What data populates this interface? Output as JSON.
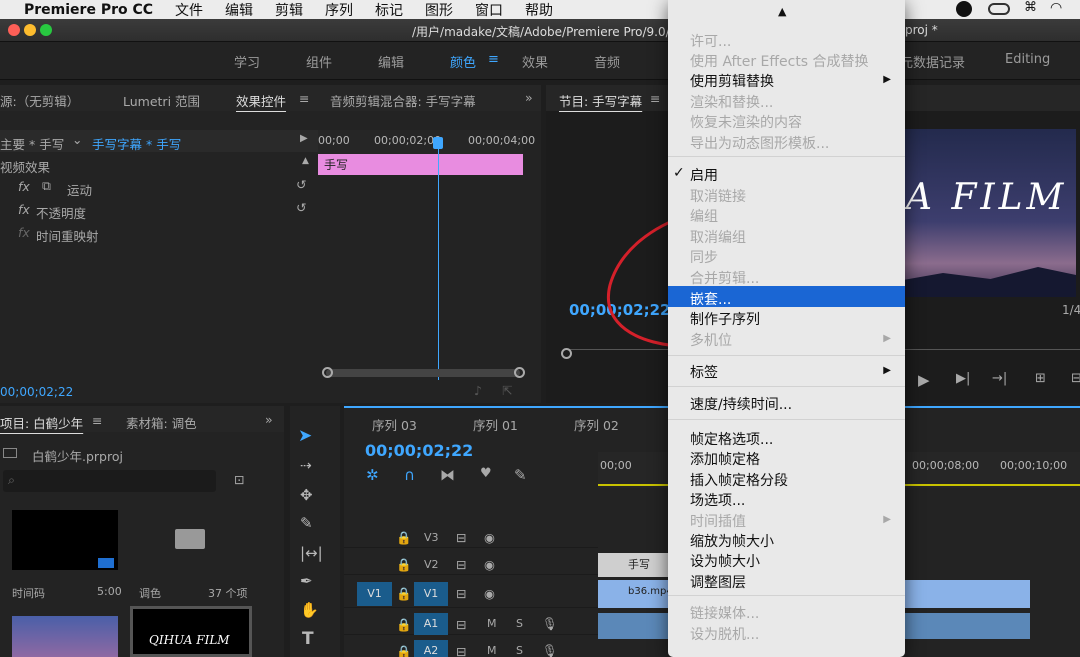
{
  "menubar": {
    "app": "Premiere Pro CC",
    "items": [
      "文件",
      "编辑",
      "剪辑",
      "序列",
      "标记",
      "图形",
      "窗口",
      "帮助"
    ]
  },
  "titlebar": {
    "path": "/用户/madake/文稿/Adobe/Premiere Pro/9.0/A",
    "path_tail": "proj *"
  },
  "workspaces": {
    "items": [
      "学习",
      "组件",
      "编辑",
      "颜色",
      "效果",
      "音频"
    ],
    "active": "颜色",
    "right1": "元数据记录",
    "right2": "Editing"
  },
  "source_panel": {
    "tabs": {
      "source": "源:（无剪辑）",
      "lumetri": "Lumetri 范围",
      "effect_controls": "效果控件",
      "audio_mixer": "音频剪辑混合器: 手写字幕"
    },
    "master": "主要 * 手写",
    "clip": "手写字幕 * 手写",
    "section": "视频效果",
    "effects": [
      "运动",
      "不透明度",
      "时间重映射"
    ],
    "ruler": [
      "00;00",
      "00;00;02;00",
      "00;00;04;00"
    ],
    "clip_label": "手写",
    "timecode": "00;00;02;22"
  },
  "program_panel": {
    "title": "节目: 手写字幕",
    "timecode": "00;00;02;22",
    "film_text": "A FILM",
    "fraction": "1/4"
  },
  "project_panel": {
    "tab": "项目: 白鹤少年",
    "bin_tab": "素材箱: 调色",
    "file": "白鹤少年.prproj",
    "item1_label": "时间码",
    "item1_value": "5:00",
    "item2_label": "调色",
    "item2_value": "37 个项",
    "thumb_text": "QIHUA FILM"
  },
  "timeline": {
    "tabs": [
      "序列 03",
      "序列 01",
      "序列 02"
    ],
    "timecode": "00;00;02;22",
    "ruler": [
      "00;00",
      "00;00;08;00",
      "00;00;10;00"
    ],
    "tracks": [
      "V3",
      "V2",
      "V1",
      "A1",
      "A2"
    ],
    "source_track": "V1",
    "clip1": "手写",
    "clip2": "b36.mp4"
  },
  "context_menu": {
    "items": [
      {
        "label": "许可...",
        "disabled": true
      },
      {
        "label": "使用 After Effects 合成替换",
        "disabled": true
      },
      {
        "label": "使用剪辑替换",
        "disabled": false,
        "submenu": true
      },
      {
        "label": "渲染和替换...",
        "disabled": true
      },
      {
        "label": "恢复未渲染的内容",
        "disabled": true
      },
      {
        "label": "导出为动态图形模板...",
        "disabled": true
      },
      {
        "label": "启用",
        "disabled": false,
        "checked": true
      },
      {
        "label": "取消链接",
        "disabled": true
      },
      {
        "label": "编组",
        "disabled": true
      },
      {
        "label": "取消编组",
        "disabled": true
      },
      {
        "label": "同步",
        "disabled": true
      },
      {
        "label": "合并剪辑...",
        "disabled": true
      },
      {
        "label": "嵌套...",
        "disabled": false,
        "selected": true
      },
      {
        "label": "制作子序列",
        "disabled": false
      },
      {
        "label": "多机位",
        "disabled": true,
        "submenu": true
      },
      {
        "label": "标签",
        "disabled": false,
        "submenu": true
      },
      {
        "label": "速度/持续时间...",
        "disabled": false
      },
      {
        "label": "帧定格选项...",
        "disabled": false
      },
      {
        "label": "添加帧定格",
        "disabled": false
      },
      {
        "label": "插入帧定格分段",
        "disabled": false
      },
      {
        "label": "场选项...",
        "disabled": false
      },
      {
        "label": "时间插值",
        "disabled": true,
        "submenu": true
      },
      {
        "label": "缩放为帧大小",
        "disabled": false
      },
      {
        "label": "设为帧大小",
        "disabled": false
      },
      {
        "label": "调整图层",
        "disabled": false
      },
      {
        "label": "链接媒体...",
        "disabled": true
      },
      {
        "label": "设为脱机...",
        "disabled": true
      }
    ]
  },
  "colors": {
    "accent": "#3fa7ff",
    "menu_select": "#1a66d4",
    "annotation": "#d4202a",
    "clip_pink": "#e88ce0"
  }
}
